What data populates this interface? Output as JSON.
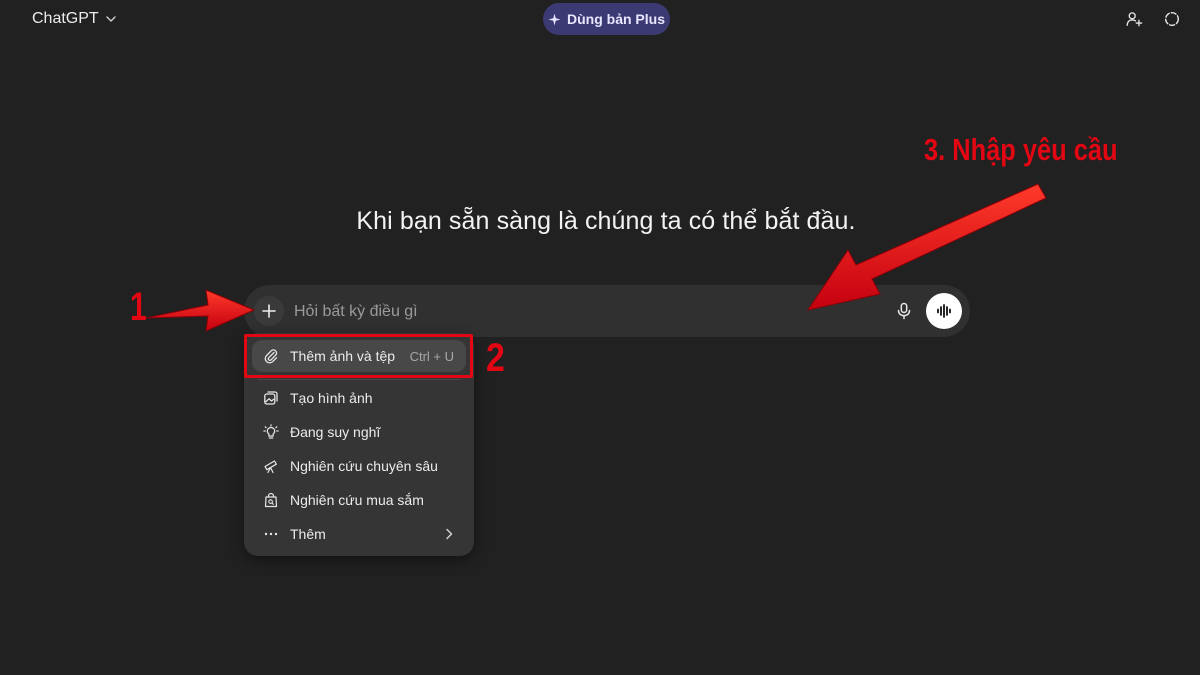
{
  "header": {
    "model_name": "ChatGPT",
    "upgrade_label": "Dùng bản Plus",
    "icons": [
      "chevron-down-icon",
      "sparkle-icon",
      "add-person-icon",
      "dashed-circle-icon"
    ]
  },
  "main": {
    "headline": "Khi bạn sẵn sàng là chúng ta có thể bắt đầu."
  },
  "composer": {
    "placeholder": "Hỏi bất kỳ điều gì",
    "value": "",
    "icons": [
      "plus-icon",
      "microphone-icon",
      "voice-waveform-icon"
    ]
  },
  "menu": {
    "items": [
      {
        "label": "Thêm ảnh và tệp",
        "shortcut": "Ctrl + U",
        "icon": "paperclip-icon",
        "active": true
      },
      {
        "label": "Tạo hình ảnh",
        "icon": "image-create-icon"
      },
      {
        "label": "Đang suy nghĩ",
        "icon": "lightbulb-icon"
      },
      {
        "label": "Nghiên cứu chuyên sâu",
        "icon": "telescope-icon"
      },
      {
        "label": "Nghiên cứu mua sắm",
        "icon": "shopping-bag-search-icon"
      },
      {
        "label": "Thêm",
        "icon": "more-dots-icon",
        "submenu": true
      }
    ]
  },
  "annotations": {
    "step1": "1",
    "step2": "2",
    "step3": "3. Nhập yêu cầu",
    "color": "#e30613"
  },
  "colors": {
    "background": "#212121",
    "composer": "#303030",
    "menu": "#353535",
    "plus_button": "#3b3a72"
  }
}
